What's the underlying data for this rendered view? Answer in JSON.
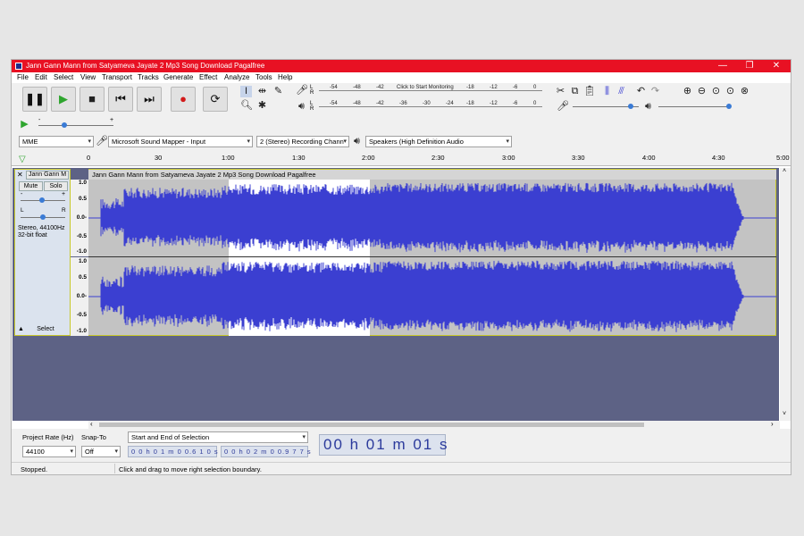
{
  "window": {
    "title": "Jann Gann Mann from Satyameva Jayate 2 Mp3 Song Download Pagalfree",
    "controls": [
      "—",
      "❐",
      "✕"
    ]
  },
  "menu": [
    "File",
    "Edit",
    "Select",
    "View",
    "Transport",
    "Tracks",
    "Generate",
    "Effect",
    "Analyze",
    "Tools",
    "Help"
  ],
  "transport": {
    "buttons": [
      "pause",
      "play",
      "stop",
      "skip-to-start",
      "skip-to-end",
      "record",
      "loop"
    ]
  },
  "meters": {
    "record_hint": "Click to Start Monitoring",
    "record_ticks": [
      "-54",
      "-48",
      "-42",
      "-18",
      "-12",
      "-6",
      "0"
    ],
    "playback_ticks": [
      "-54",
      "-48",
      "-42",
      "-36",
      "-30",
      "-24",
      "-18",
      "-12",
      "-6",
      "0"
    ],
    "lr_l": "L",
    "lr_r": "R"
  },
  "device": {
    "host": "MME",
    "input": "Microsoft Sound Mapper - Input",
    "channels": "2 (Stereo) Recording Chann",
    "output": "Speakers (High Definition Audio"
  },
  "play_at_speed": {
    "minus": "-",
    "plus": "+"
  },
  "timeline": {
    "ticks": [
      "0",
      "30",
      "1:00",
      "1:30",
      "2:00",
      "2:30",
      "3:00",
      "3:30",
      "4:00",
      "4:30",
      "5:00"
    ]
  },
  "track": {
    "name": "Jann Gann M",
    "clip_title": "Jann Gann Mann from Satyameva Jayate 2 Mp3 Song Download Pagalfree",
    "mute": "Mute",
    "solo": "Solo",
    "gain_minus": "-",
    "gain_plus": "+",
    "pan_l": "L",
    "pan_r": "R",
    "info_line1": "Stereo, 44100Hz",
    "info_line2": "32-bit float",
    "select": "Select",
    "vruler_ticks": [
      "1.0",
      "0.5",
      "0.0-",
      "-0.5",
      "-1.0"
    ]
  },
  "selection_toolbar": {
    "project_rate_label": "Project Rate (Hz)",
    "project_rate_value": "44100",
    "snap_to_label": "Snap-To",
    "snap_to_value": "Off",
    "selection_mode": "Start and End of Selection",
    "start_time": "0 0 h 0 1 m 0 0.6 1 0 s",
    "end_time": "0 0 h 0 2 m 0 0.9 7 7 s",
    "audio_position": "00 h 01 m 01 s"
  },
  "status": {
    "state": "Stopped.",
    "hint": "Click and drag to move right selection boundary."
  },
  "colors": {
    "title_bar": "#e81123",
    "waveform": "#3b3fd1",
    "track_area": "#5d6285"
  }
}
